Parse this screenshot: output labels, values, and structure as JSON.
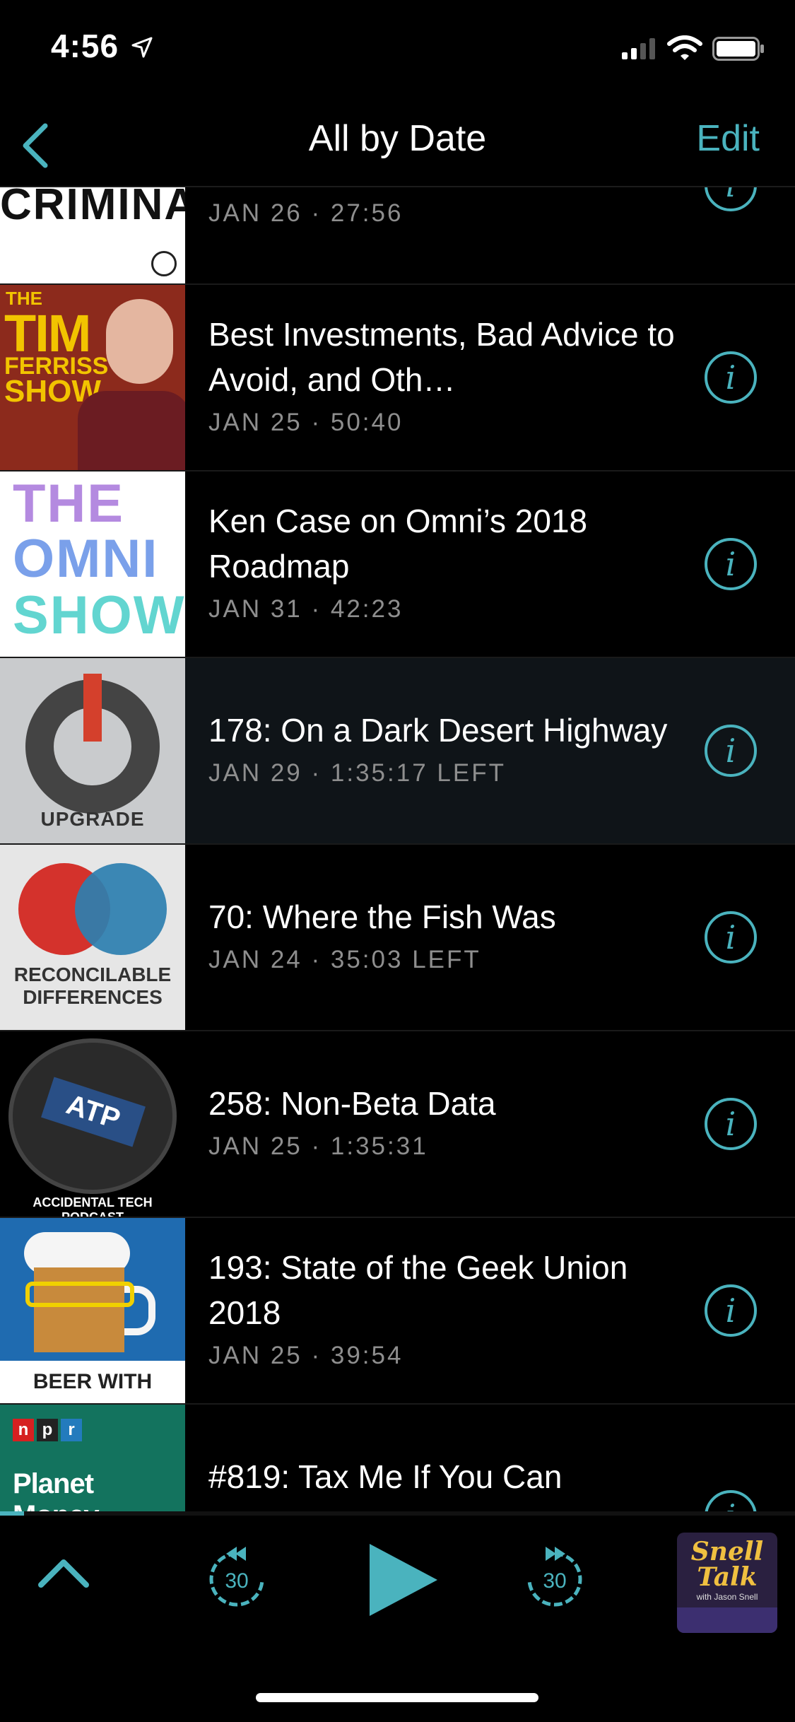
{
  "status_bar": {
    "time": "4:56"
  },
  "nav": {
    "title": "All by Date",
    "edit_label": "Edit"
  },
  "episodes": [
    {
      "podcast_art_text": "CRIMINAL",
      "title": "",
      "meta": "JAN 26 · 27:56"
    },
    {
      "podcast_art_text": "THE TIM FERRISS SHOW",
      "title": "Best Investments, Bad Advice to Avoid, and Oth…",
      "meta": "JAN 25 · 50:40"
    },
    {
      "podcast_art_text": "THE OMNI SHOW",
      "title": "Ken Case on Omni’s 2018 Roadmap",
      "meta": "JAN 31 · 42:23"
    },
    {
      "podcast_art_text": "UPGRADE",
      "title": "178: On a Dark Desert Highway",
      "meta": "JAN 29 · 1:35:17 LEFT"
    },
    {
      "podcast_art_text": "RECONCILABLE DIFFERENCES",
      "title": "70: Where the Fish Was",
      "meta": "JAN 24 · 35:03 LEFT"
    },
    {
      "podcast_art_text": "ACCIDENTAL TECH PODCAST",
      "title": "258: Non-Beta Data",
      "meta": "JAN 25 · 1:35:31"
    },
    {
      "podcast_art_text": "BEER WITH GEEKS",
      "title": "193: State of the Geek Union 2018",
      "meta": "JAN 25 · 39:54"
    },
    {
      "podcast_art_text": "Planet Money",
      "title": "#819: Tax Me If You Can",
      "meta": ""
    }
  ],
  "info_glyph": "i",
  "player": {
    "skip_back_seconds": "30",
    "skip_forward_seconds": "30",
    "progress_fraction": 0.03,
    "now_playing_art": {
      "line1": "Snell",
      "line2": "Talk",
      "line3": "with Jason Snell"
    }
  },
  "colors": {
    "accent": "#4ab3be",
    "background": "#000000",
    "meta_text": "#8e8e8e"
  }
}
